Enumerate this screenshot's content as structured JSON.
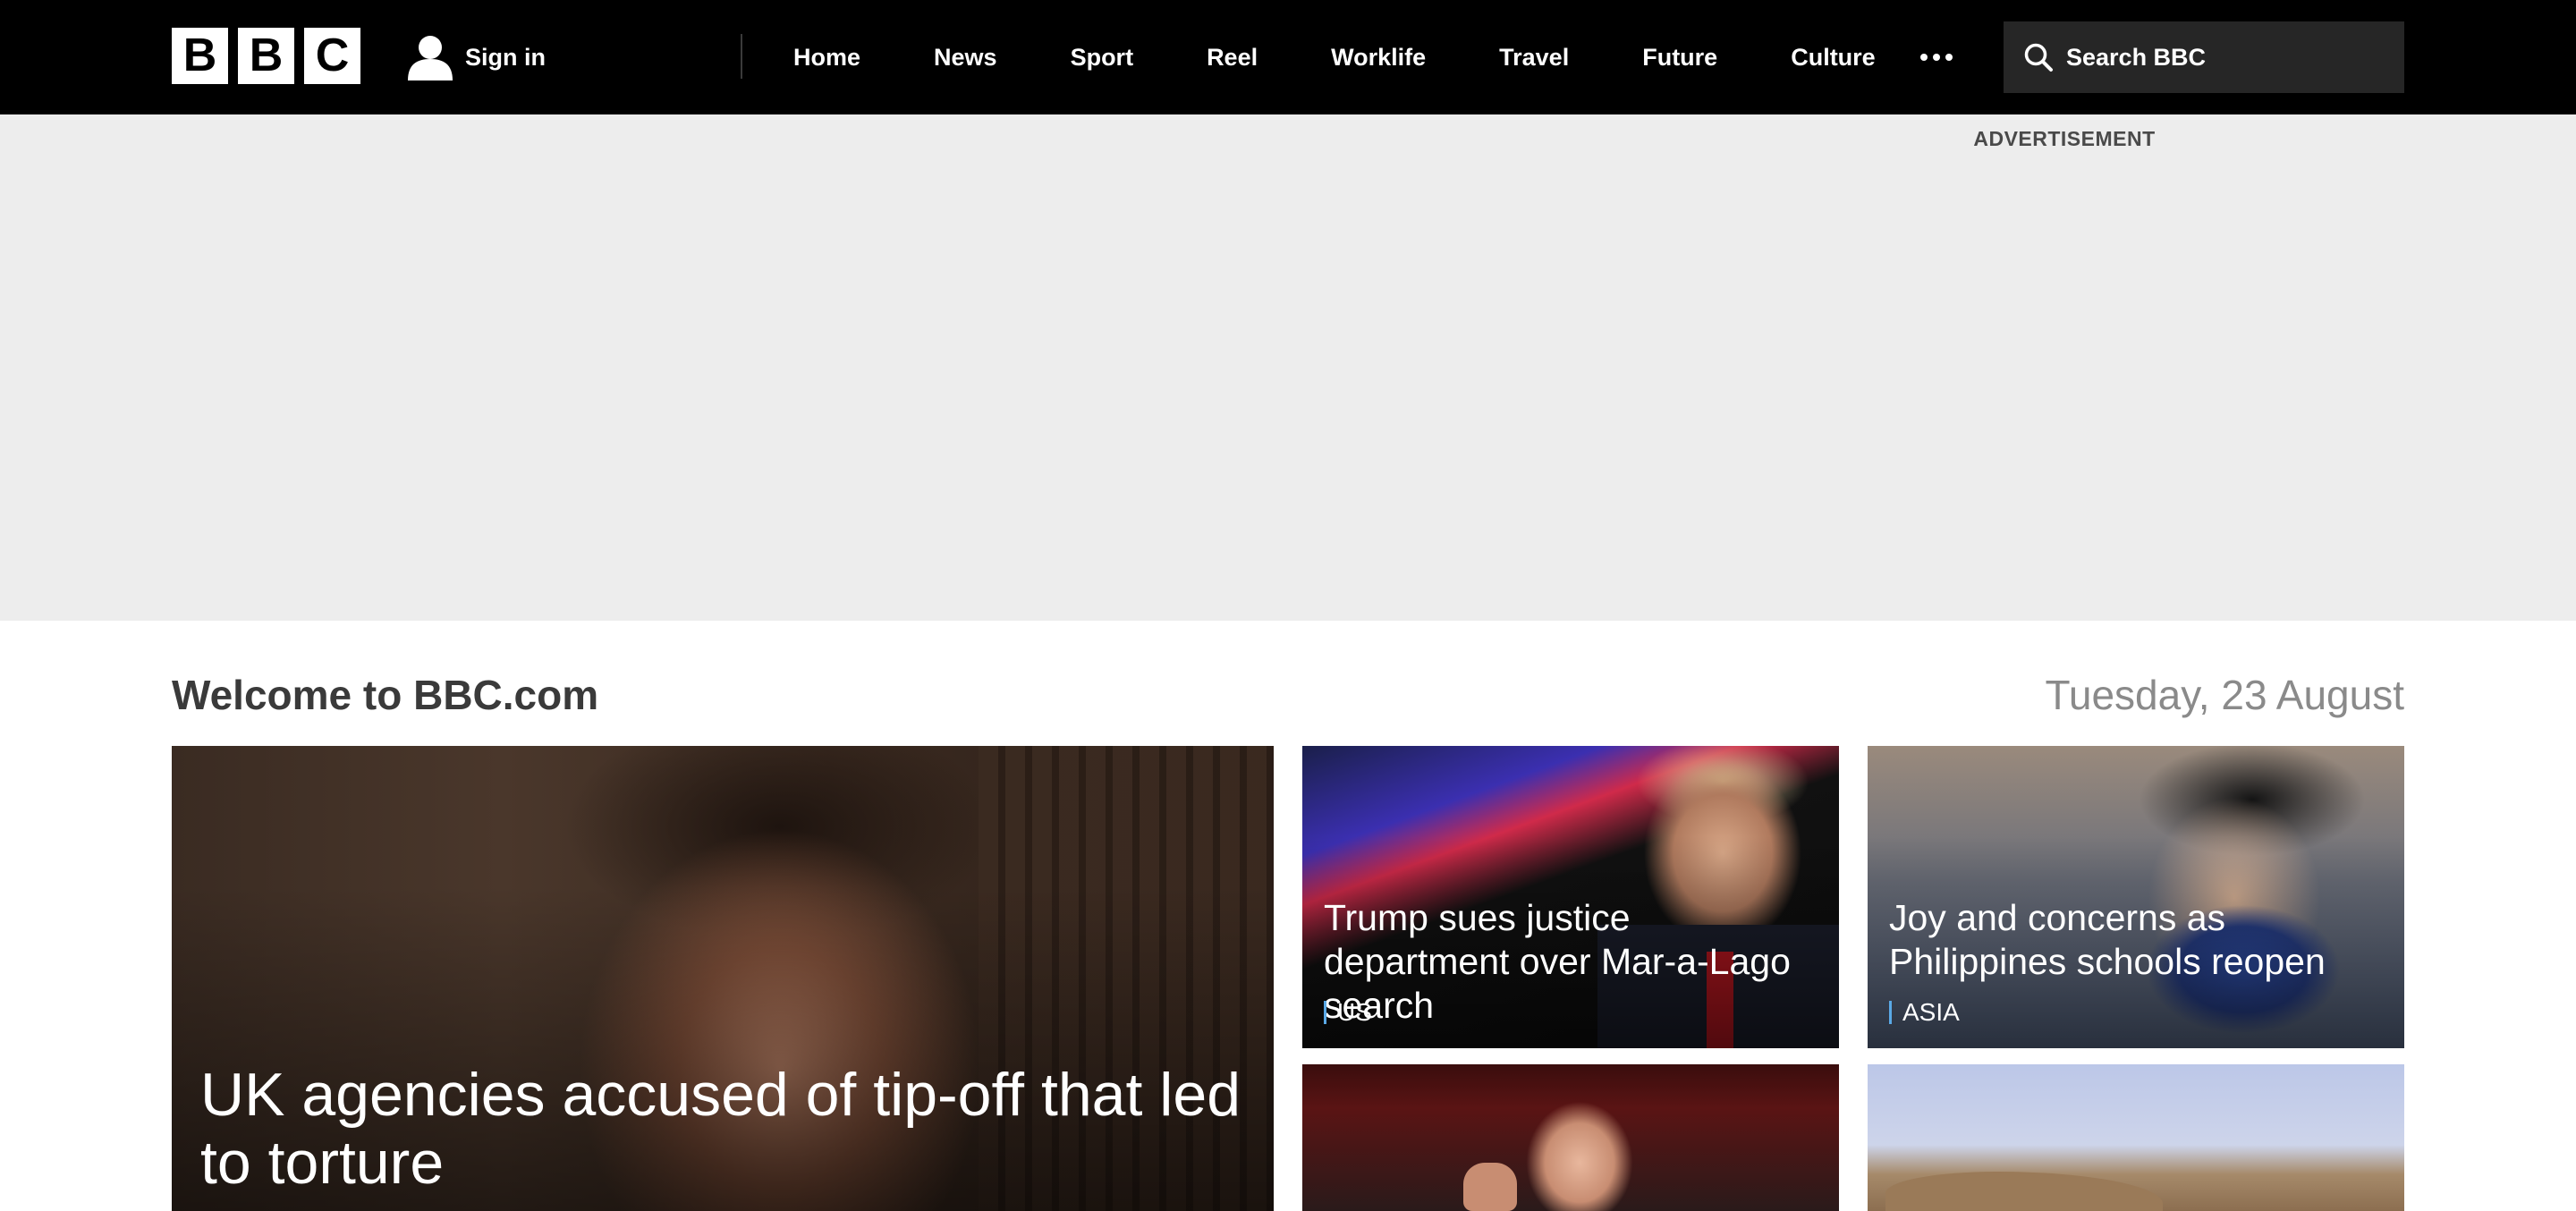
{
  "header": {
    "logo_letters": [
      "B",
      "B",
      "C"
    ],
    "signin_label": "Sign in",
    "nav": [
      "Home",
      "News",
      "Sport",
      "Reel",
      "Worklife",
      "Travel",
      "Future",
      "Culture"
    ],
    "more_icon": "more-dots-icon",
    "search_placeholder": "Search BBC"
  },
  "ad": {
    "label": "ADVERTISEMENT"
  },
  "welcome": {
    "title": "Welcome to BBC.com",
    "date": "Tuesday, 23 August"
  },
  "stories": {
    "main": {
      "headline": "UK agencies accused of tip-off that led to torture"
    },
    "trump": {
      "headline": "Trump sues justice department over Mar-a-Lago search",
      "tag": "US"
    },
    "philippines": {
      "headline": "Joy and concerns as Philippines schools reopen",
      "tag": "ASIA"
    }
  },
  "colors": {
    "topbar": "#000000",
    "adband": "#ededed",
    "tag_accent": "#5aa9e6"
  }
}
